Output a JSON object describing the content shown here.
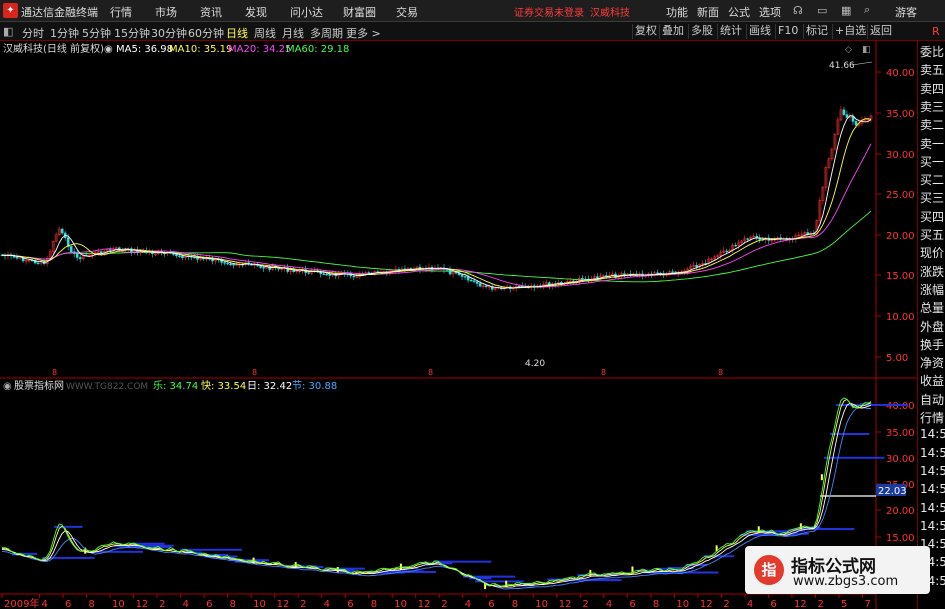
{
  "titlebar": {
    "app_title": "通达信金融终端",
    "menus": [
      "行情",
      "市场",
      "资讯",
      "发现",
      "问小达",
      "财富圈",
      "交易"
    ],
    "login_status": "证券交易未登录",
    "stock_name": "汉威科技",
    "tools": [
      "功能",
      "新面",
      "公式",
      "选项"
    ],
    "user": "游客"
  },
  "periodbar": {
    "periods": [
      "分时",
      "1分钟",
      "5分钟",
      "15分钟",
      "30分钟",
      "60分钟",
      "日线",
      "周线",
      "月线",
      "多周期",
      "更多 >"
    ],
    "active_period": "日线",
    "right_buttons": [
      "复权",
      "叠加",
      "多股",
      "统计",
      "画线",
      "F10",
      "标记",
      "+自选",
      "返回"
    ]
  },
  "main_panel": {
    "legend_prefix": "汉威科技(日线 前复权)",
    "ma": [
      {
        "label": "MA5: 36.98",
        "color": "#ffffff"
      },
      {
        "label": "MA10: 35.19",
        "color": "#ffff44"
      },
      {
        "label": "MA20: 34.25",
        "color": "#ff44ff"
      },
      {
        "label": "MA60: 29.18",
        "color": "#44ff44"
      }
    ],
    "y_ticks": [
      "40.00",
      "35.00",
      "30.00",
      "25.00",
      "20.00",
      "15.00",
      "10.00",
      "5.00"
    ],
    "high_label": "41.66",
    "low_label": "4.20",
    "flag_marker": "8"
  },
  "sub_panel": {
    "legend_prefix": "股票指标网",
    "watermark_text": "WWW.TG822.COM",
    "legend_items": [
      {
        "label": "乐: 34.74",
        "color": "#44ff44"
      },
      {
        "label": "快: 33.54",
        "color": "#ffff44"
      },
      {
        "label": "日: 32.42",
        "color": "#ffffff"
      },
      {
        "label": "节: 30.88",
        "color": "#44aaff"
      }
    ],
    "y_ticks": [
      "40.00",
      "35.00",
      "30.00",
      "25.00",
      "20.00",
      "15.00",
      "10.00"
    ],
    "highlight_value": "22.03"
  },
  "x_axis": {
    "labels": [
      "2009年",
      "4",
      "6",
      "8",
      "10",
      "12",
      "2",
      "4",
      "6",
      "8",
      "10",
      "12",
      "2",
      "4",
      "6",
      "8",
      "10",
      "12",
      "2",
      "4",
      "6",
      "8",
      "10",
      "12",
      "2",
      "4",
      "6",
      "8",
      "10",
      "12",
      "2",
      "4",
      "6",
      "12",
      "2",
      "5",
      "7"
    ]
  },
  "side_panel": {
    "items": [
      "委比",
      "卖五",
      "卖四",
      "卖三",
      "卖二",
      "卖一",
      "买一",
      "买二",
      "买三",
      "买四",
      "买五",
      "现价",
      "涨跌",
      "涨幅",
      "总量",
      "外盘",
      "换手",
      "净资",
      "收益",
      "自动",
      "行情",
      "14:50",
      "14:50",
      "14:50",
      "14:50",
      "14:50",
      "14:50",
      "14:50",
      "14:50",
      "14:50"
    ]
  },
  "watermark_box": {
    "title": "指标公式网",
    "url": "www.zbgs3.com"
  },
  "colors": {
    "up": "#ff3333",
    "down": "#33dddd",
    "ma5": "#ffffff",
    "ma10": "#ffff44",
    "ma20": "#ff44ff",
    "ma60": "#44ff44",
    "axis": "#aa0000",
    "accent": "#d9251c"
  }
}
